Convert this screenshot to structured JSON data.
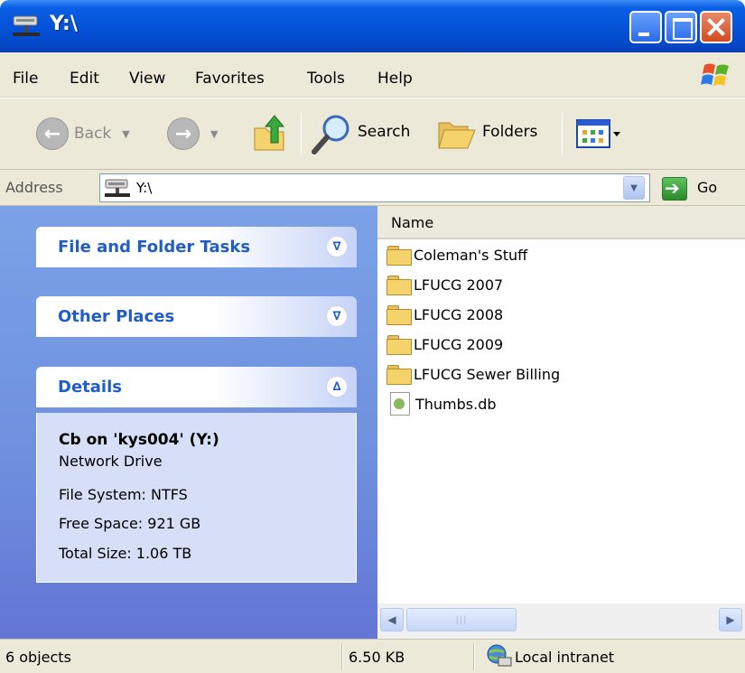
{
  "window": {
    "title": "Y:\\"
  },
  "menu": {
    "items": [
      "File",
      "Edit",
      "View",
      "Favorites",
      "Tools",
      "Help"
    ]
  },
  "toolbar": {
    "back_label": "Back",
    "search_label": "Search",
    "folders_label": "Folders"
  },
  "address": {
    "label": "Address",
    "value": "Y:\\",
    "go_label": "Go"
  },
  "tasks": {
    "file_folder_tasks": "File and Folder Tasks",
    "other_places": "Other Places",
    "details": "Details"
  },
  "details": {
    "name": "Cb on 'kys004' (Y:)",
    "type": "Network Drive",
    "file_system": "File System: NTFS",
    "free_space": "Free Space: 921 GB",
    "total_size": "Total Size: 1.06 TB"
  },
  "content": {
    "column_name": "Name",
    "files": [
      {
        "name": "Coleman's Stuff",
        "icon": "folder-icon"
      },
      {
        "name": "LFUCG 2007",
        "icon": "folder-icon"
      },
      {
        "name": "LFUCG 2008",
        "icon": "folder-icon"
      },
      {
        "name": "LFUCG 2009",
        "icon": "folder-icon"
      },
      {
        "name": "LFUCG Sewer Billing",
        "icon": "folder-icon"
      },
      {
        "name": "Thumbs.db",
        "icon": "database-file-icon"
      }
    ]
  },
  "status": {
    "objects": "6 objects",
    "size": "6.50 KB",
    "zone": "Local intranet"
  }
}
